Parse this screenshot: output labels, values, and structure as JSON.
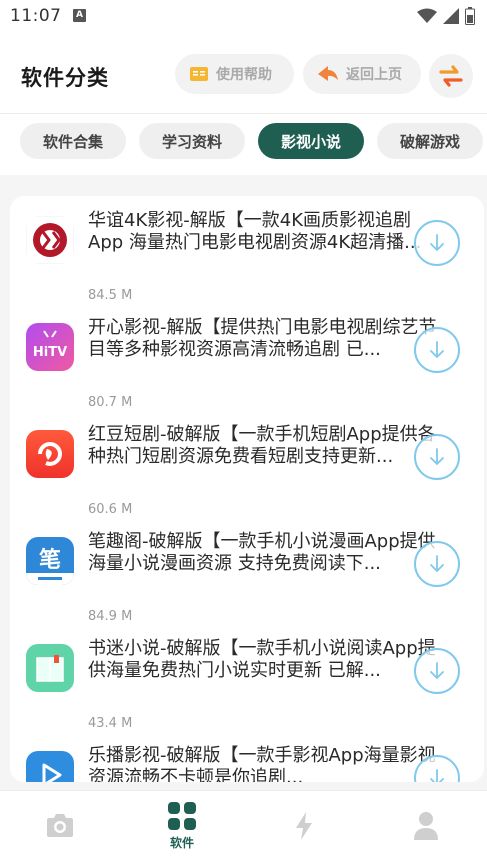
{
  "status_bar": {
    "time": "11:07",
    "notification_letter": "A"
  },
  "header": {
    "title": "软件分类",
    "help_label": "使用帮助",
    "back_label": "返回上页",
    "swap_icon": "swap-arrows-icon"
  },
  "tabs": [
    {
      "label": "软件合集",
      "active": false
    },
    {
      "label": "学习资料",
      "active": false
    },
    {
      "label": "影视小说",
      "active": true
    },
    {
      "label": "破解游戏",
      "active": false
    }
  ],
  "items": [
    {
      "title": "华谊4K影视-解版【一款4K画质影视追剧App 海量热门电影电视剧资源4K超清播...",
      "size": "84.5 M",
      "icon": "huayi-4k-logo"
    },
    {
      "title": "开心影视-解版【提供热门电影电视剧综艺节目等多种影视资源高清流畅追剧 已...",
      "size": "80.7 M",
      "icon": "hitv-logo"
    },
    {
      "title": "红豆短剧-破解版【一款手机短剧App提供各种热门短剧资源免费看短剧支持更新...",
      "size": "60.6 M",
      "icon": "red-bean-logo"
    },
    {
      "title": "笔趣阁-破解版【一款手机小说漫画App提供海量小说漫画资源 支持免费阅读下...",
      "size": "84.9 M",
      "icon": "biquge-logo"
    },
    {
      "title": "书迷小说-破解版【一款手机小说阅读App提供海量免费热门小说实时更新 已解...",
      "size": "43.4 M",
      "icon": "book-logo"
    },
    {
      "title": "乐播影视-破解版【一款手影视App海量影视资源流畅不卡顿是你追剧...",
      "size": "",
      "icon": "lebo-logo"
    }
  ],
  "bottom_nav": {
    "items": [
      {
        "icon": "camera-icon",
        "label": ""
      },
      {
        "icon": "grid-icon",
        "label": "软件"
      },
      {
        "icon": "lightning-icon",
        "label": ""
      },
      {
        "icon": "person-icon",
        "label": ""
      }
    ]
  },
  "colors": {
    "accent": "#1f5f52",
    "download_ring": "#7fc9ec",
    "help_icon": "#f5b731",
    "back_icon": "#f0843c"
  }
}
